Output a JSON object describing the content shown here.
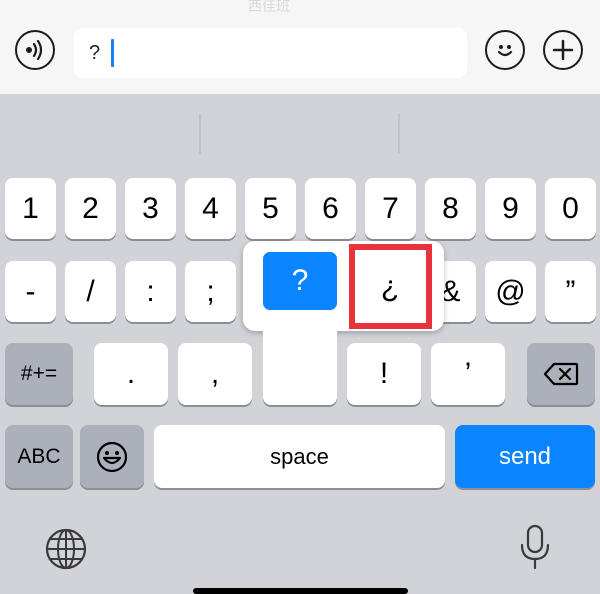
{
  "topbar": {
    "watermark": "西佳班",
    "input_value": "?",
    "voice_icon": "voice-wave-icon",
    "emoji_icon": "smiley-icon",
    "add_icon": "plus-circle-icon"
  },
  "keyboard": {
    "number_row": [
      "1",
      "2",
      "3",
      "4",
      "5",
      "6",
      "7",
      "8",
      "9",
      "0"
    ],
    "symbol_row": [
      "-",
      "/",
      ":",
      ";",
      "&",
      "@",
      "”"
    ],
    "third_row": {
      "switch_label": "#+=",
      "period": ".",
      "comma": ",",
      "exclamation": "!",
      "apostrophe": "’",
      "delete_icon": "backspace-icon"
    },
    "bottom_row": {
      "abc_label": "ABC",
      "emoji_icon": "emoji-icon",
      "space_label": "space",
      "send_label": "send"
    },
    "popup": {
      "options": [
        "?",
        "¿"
      ],
      "selected": "?"
    },
    "globe_icon": "globe-icon",
    "mic_icon": "microphone-icon"
  },
  "colors": {
    "accent": "#0a84ff",
    "highlight": "#e8333c",
    "keyboard_bg": "#d1d3d9"
  }
}
